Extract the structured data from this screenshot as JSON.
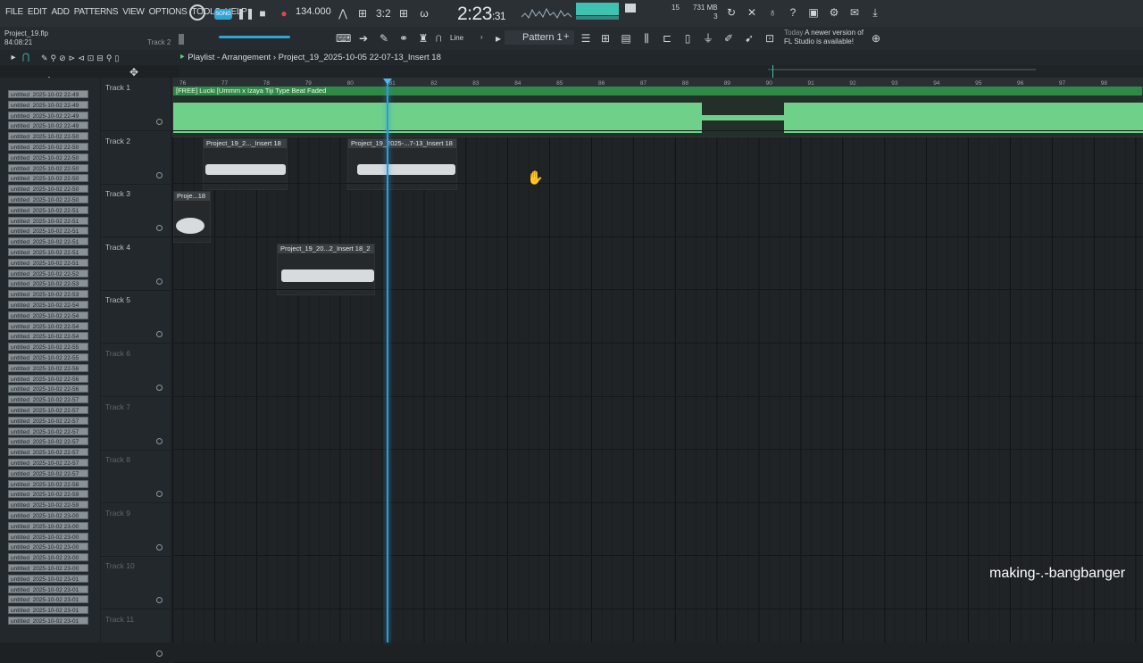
{
  "menu": [
    "FILE",
    "EDIT",
    "ADD",
    "PATTERNS",
    "VIEW",
    "OPTIONS",
    "TOOLS",
    "HELP"
  ],
  "transport": {
    "tempo": "134.000",
    "time_main": "2:23",
    "time_sub": "31",
    "mem": "731 MB",
    "mem_sub": "3",
    "poly": "15",
    "song_label": "SONG"
  },
  "project": {
    "file": "Project_19.flp",
    "time": "84:08:21",
    "hint": "Track 2"
  },
  "toolbar": {
    "snap": "Line",
    "pattern": "Pattern 1"
  },
  "news": {
    "date": "Today",
    "text1": "A newer version of",
    "text2": "FL Studio is available!"
  },
  "playlist": {
    "title": "Playlist - Arrangement",
    "path": "Project_19_2025-10-05 22-07-13_Insert 18"
  },
  "ruler": [
    "76",
    "77",
    "78",
    "79",
    "80",
    "81",
    "82",
    "83",
    "84",
    "85",
    "86",
    "87",
    "88",
    "89",
    "90",
    "91",
    "92",
    "93",
    "94",
    "95",
    "96",
    "97",
    "98"
  ],
  "tracks": [
    "Track 1",
    "Track 2",
    "Track 3",
    "Track 4",
    "Track 5",
    "Track 6",
    "Track 7",
    "Track 8",
    "Track 9",
    "Track 10",
    "Track 11"
  ],
  "clips": {
    "c1": "[FREE] Lucki [Ummm x Izaya Tiji Type Beat Faded",
    "c2": "Project_19_2..._Insert 18",
    "c3": "Project_19_2025-...7-13_Insert 18",
    "c4": "Proje...18",
    "c5": "Project_19_20...2_Insert 18_2"
  },
  "browser_items": [
    "untitled_2025-10-02 22-49",
    "untitled_2025-10-02 22-49",
    "untitled_2025-10-02 22-49",
    "untitled_2025-10-02 22-49",
    "untitled_2025-10-02 22-50",
    "untitled_2025-10-02 22-50",
    "untitled_2025-10-02 22-50",
    "untitled_2025-10-02 22-50",
    "untitled_2025-10-02 22-50",
    "untitled_2025-10-02 22-50",
    "untitled_2025-10-02 22-50",
    "untitled_2025-10-02 22-51",
    "untitled_2025-10-02 22-51",
    "untitled_2025-10-02 22-51",
    "untitled_2025-10-02 22-51",
    "untitled_2025-10-02 22-51",
    "untitled_2025-10-02 22-51",
    "untitled_2025-10-02 22-52",
    "untitled_2025-10-02 22-53",
    "untitled_2025-10-02 22-53",
    "untitled_2025-10-02 22-54",
    "untitled_2025-10-02 22-54",
    "untitled_2025-10-02 22-54",
    "untitled_2025-10-02 22-54",
    "untitled_2025-10-02 22-55",
    "untitled_2025-10-02 22-55",
    "untitled_2025-10-02 22-56",
    "untitled_2025-10-02 22-56",
    "untitled_2025-10-02 22-56",
    "untitled_2025-10-02 22-57",
    "untitled_2025-10-02 22-57",
    "untitled_2025-10-02 22-57",
    "untitled_2025-10-02 22-57",
    "untitled_2025-10-02 22-57",
    "untitled_2025-10-02 22-57",
    "untitled_2025-10-02 22-57",
    "untitled_2025-10-02 22-57",
    "untitled_2025-10-02 22-58",
    "untitled_2025-10-02 22-59",
    "untitled_2025-10-02 22-59",
    "untitled_2025-10-02 23-00",
    "untitled_2025-10-02 23-00",
    "untitled_2025-10-02 23-00",
    "untitled_2025-10-02 23-00",
    "untitled_2025-10-02 23-00",
    "untitled_2025-10-02 23-00",
    "untitled_2025-10-02 23-01",
    "untitled_2025-10-02 23-01",
    "untitled_2025-10-02 23-01",
    "untitled_2025-10-02 23-01",
    "untitled_2025-10-02 23-01"
  ],
  "watermark": "making-.-bangbanger",
  "colors": {
    "accent": "#3ec3b1",
    "playhead": "#2f9ad6",
    "audio_clip": "#6fd08a",
    "loop": "#27a23c"
  }
}
